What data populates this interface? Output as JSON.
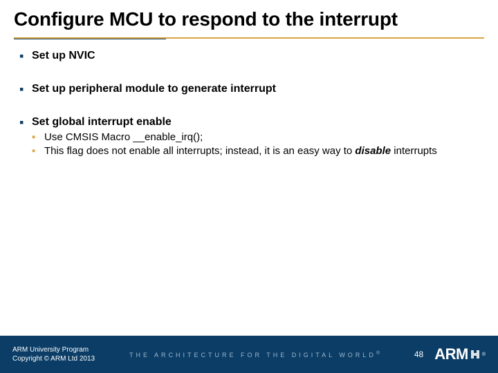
{
  "title": "Configure MCU to respond to the interrupt",
  "bullets": [
    {
      "text": "Set up NVIC"
    },
    {
      "text": "Set up peripheral module to generate interrupt"
    },
    {
      "text": "Set global interrupt enable",
      "children": [
        {
          "text": "Use CMSIS Macro __enable_irq();"
        },
        {
          "pre": "This flag does not enable all interrupts; instead, it is an easy way to ",
          "em": "disable",
          "post": " interrupts"
        }
      ]
    }
  ],
  "footer": {
    "line1": "ARM University Program",
    "line2": "Copyright © ARM Ltd 2013",
    "tagline": "THE ARCHITECTURE FOR THE DIGITAL WORLD",
    "tagline_mark": "®",
    "page": "48",
    "logo_text": "ARM",
    "logo_mark": "®"
  },
  "colors": {
    "footer_bg": "#0b3d66",
    "gold": "#d9a441"
  }
}
